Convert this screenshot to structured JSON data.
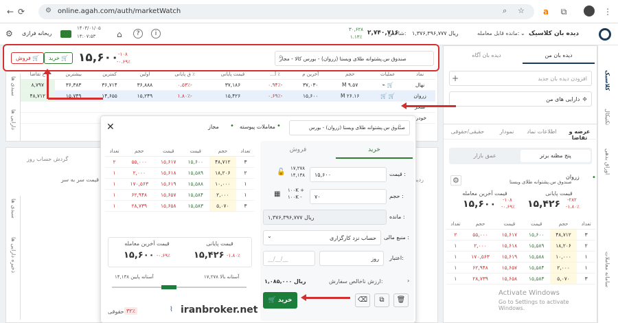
{
  "browser": {
    "url": "online.agah.com/auth/marketWatch"
  },
  "header": {
    "title": "دیده بان کلاسیک",
    "tradable_label": "مانده قابل معامله:",
    "tradable_value": "۱,۳۷۶,۳۹۶,۷۷۷ ریال",
    "index_label": "شاخص:",
    "index_value": "۲,۷۴۰,۷۱۶",
    "index_change": "۳۰,۶۲۸",
    "index_pct": "۱.۱۳٪",
    "user": "ریحانه فرازی",
    "date": "۱۴۰۳/۰۱/۰۵",
    "time": "۱۴:۰۷:۵۳"
  },
  "top_symbol": {
    "search_value": "صندوق س.پشتوانه طلای ویستا (زروان) - بورس کالا - مجاز",
    "price": "۱۵,۶۰۰",
    "change": "-۱۰۸",
    "pct": "-۰.۶۹٪",
    "buy_label": "خرید",
    "sell_label": "فروش"
  },
  "left_sidebar": {
    "tab_my": "دیده بان من",
    "tab_agah": "دیده بان آگاه",
    "add_placeholder": "افزودن دیده بان جدید",
    "assets_label": "دارایی های من"
  },
  "far_right": {
    "tabs": [
      "کلاسیک",
      "تکنیکال",
      "اوراق بدهی"
    ],
    "bottom_tab": "سامانه معاملات"
  },
  "watch": {
    "headers": [
      "نماد",
      "عملیات",
      "حجم",
      "آخرین م",
      "٪ آ...",
      "قیمت پایانی",
      "٪ ق پایانی",
      "اولین",
      "کمترین",
      "بیشترین",
      "ح تقاضا"
    ],
    "rows": [
      {
        "sym": "نهال",
        "vol": "۹.۵۷ M",
        "last": "۳۷,۰۳۰",
        "lastp": "-۰.۹۴٪",
        "close": "۳۷,۱۸۶",
        "closep": "-۰.۵۳٪",
        "first": "۳۶,۸۸۸",
        "low": "۳۶,۷۱۴",
        "high": "۳۶,۳۸۳",
        "bid": "۸,۷۹۷"
      },
      {
        "sym": "زروان",
        "vol": "۲۶.۱۶ M",
        "last": "۱۵,۶۰۰",
        "lastp": "-۰.۶۹٪",
        "close": "۱۵,۴۲۶",
        "closep": "-۱.۸۰٪",
        "first": "۱۵,۲۴۹",
        "low": "۱۴,۶۵۵",
        "high": "۱۵,۷۴۹",
        "bid": "۴۸,۷۱۲"
      },
      {
        "sym": "سحر"
      },
      {
        "sym": "خودرو"
      }
    ]
  },
  "left_bottom": {
    "tabs": [
      "عرضه و تقاضا",
      "اطلاعات نماد",
      "نمودار",
      "حقیقی/حقوقی"
    ],
    "subtabs": [
      "پنج مظنه برتر",
      "عمق بازار"
    ],
    "symbol": "زروان",
    "symbol_full": "صندوق س.پشتوانه طلای ویستا",
    "last_label": "قیمت آخرین معامله",
    "last_price": "۱۵,۶۰۰",
    "last_change": "-۱۰۸",
    "last_pct": "-۰.۶۹٪",
    "close_label": "قیمت پایانی",
    "close_price": "۱۵,۴۲۶",
    "close_change": "-۲۸۲",
    "close_pct": "-۱.۸۰٪"
  },
  "order_book": {
    "headers": [
      "تعداد",
      "حجم",
      "قیمت",
      "قیمت",
      "حجم",
      "تعداد"
    ],
    "rows": [
      {
        "bc": "۳",
        "bv": "۴۸,۷۱۲",
        "bp": "۱۵,۶۰۰",
        "ap": "۱۵,۶۱۷",
        "av": "۵۵,۰۰۰",
        "ac": "۲"
      },
      {
        "bc": "۲",
        "bv": "۱۸,۲۰۶",
        "bp": "۱۵,۵۸۹",
        "ap": "۱۵,۶۱۸",
        "av": "۲,۰۰۰",
        "ac": "۱"
      },
      {
        "bc": "۱",
        "bv": "۱۰,۰۰۰",
        "bp": "۱۵,۵۸۸",
        "ap": "۱۵,۶۱۹",
        "av": "۱۷۰,۵۶۳",
        "ac": "۱"
      },
      {
        "bc": "۱",
        "bv": "۲,۰۰۰",
        "bp": "۱۵,۵۸۴",
        "ap": "۱۵,۶۵۷",
        "av": "۶۲,۹۴۸",
        "ac": "۱"
      },
      {
        "bc": "۳",
        "bv": "۵,۰۷۰",
        "bp": "۱۵,۵۸۳",
        "ap": "۱۵,۶۵۸",
        "av": "۲۸,۷۳۹",
        "ac": "۱"
      }
    ]
  },
  "dialog": {
    "search": "صندوق س.پشتوانه طلای ویستا (زروان) - بورس",
    "continuous": "معاملات پیوسته",
    "allowed": "مجاز",
    "tab_buy": "خرید",
    "tab_sell": "فروش",
    "price_label": "قیمت :",
    "price_value": "۱۵,۶۰۰",
    "price_upper": "۱۷,۲۷۸",
    "price_lower": "۱۴,۱۳۸",
    "volume_label": "حجم :",
    "volume_value": "۷۰",
    "step_plus": "۱۰۰K +",
    "step_minus": "۱۰۰K -",
    "balance_label": "مانده :",
    "balance_value": "۱,۳۷۶,۳۹۶,۷۷۷ ریال",
    "source_label": "منبع مالی :",
    "source_value": "حساب نزد کارگزاری",
    "validity_label": "اعتبار:",
    "validity_value": "روز",
    "date_placeholder": "__/__/__",
    "net_label": "ارزش ناخالص سفارش:",
    "net_value": "۱,۰۸۵,۰۰۰ ریال",
    "buy_button": "خرید",
    "close_label": "قیمت پایانی",
    "close_price": "۱۵,۴۲۶",
    "close_pct": "-۱.۸۰٪",
    "last_label": "قیمت آخرین معامله",
    "last_price": "۱۵,۶۰۰",
    "last_pct": "-۰.۶۹٪",
    "upper_label": "آستانه بالا ۱۷,۲۷۸",
    "lower_label": "آستانه پایین ۱۴,۱۳۸",
    "legal_label": "حقوقی",
    "legal_pct": "۳۲٪",
    "watermark": "iranbroker.net"
  },
  "bg_panel": {
    "tab1": "گردش حساب روز",
    "col": "قیمت سر به سر",
    "tab2": "ردیف"
  },
  "windows": {
    "line1": "Activate Windows",
    "line2": "Go to Settings to activate Windows."
  },
  "vertical_tabs": [
    "سبدی ها",
    "دارایی ها",
    "سبدی ها",
    "ذخیره دارایی ها"
  ]
}
